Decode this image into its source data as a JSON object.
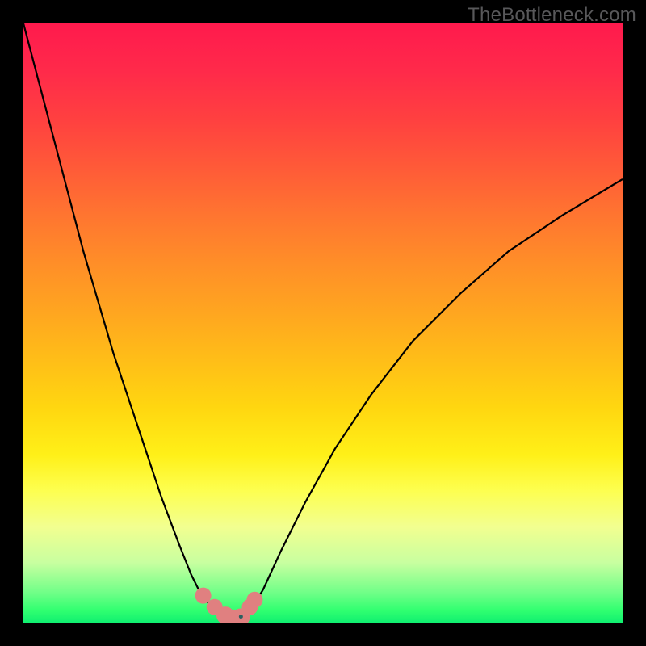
{
  "watermark": "TheBottleneck.com",
  "chart_data": {
    "type": "line",
    "title": "",
    "xlabel": "",
    "ylabel": "",
    "xlim": [
      0,
      1
    ],
    "ylim": [
      0,
      1
    ],
    "series": [
      {
        "name": "left-branch",
        "x": [
          0.0,
          0.05,
          0.1,
          0.15,
          0.2,
          0.23,
          0.26,
          0.28,
          0.3,
          0.33
        ],
        "y": [
          1.0,
          0.81,
          0.62,
          0.45,
          0.3,
          0.21,
          0.13,
          0.08,
          0.04,
          0.015
        ]
      },
      {
        "name": "valley",
        "x": [
          0.33,
          0.345,
          0.36,
          0.375
        ],
        "y": [
          0.015,
          0.006,
          0.006,
          0.015
        ]
      },
      {
        "name": "right-branch",
        "x": [
          0.375,
          0.4,
          0.43,
          0.47,
          0.52,
          0.58,
          0.65,
          0.73,
          0.81,
          0.9,
          1.0
        ],
        "y": [
          0.015,
          0.055,
          0.12,
          0.2,
          0.29,
          0.38,
          0.47,
          0.55,
          0.62,
          0.68,
          0.74
        ]
      }
    ],
    "markers": [
      {
        "name": "left-upper-dot",
        "x": 0.3,
        "y": 0.045,
        "r": 10
      },
      {
        "name": "left-lower-dot",
        "x": 0.319,
        "y": 0.026,
        "r": 10
      },
      {
        "name": "bottom-left-dot",
        "x": 0.337,
        "y": 0.012,
        "r": 11
      },
      {
        "name": "bottom-mid1-dot",
        "x": 0.35,
        "y": 0.007,
        "r": 11
      },
      {
        "name": "bottom-mid2-dot",
        "x": 0.363,
        "y": 0.009,
        "r": 11
      },
      {
        "name": "right-dot-1",
        "x": 0.378,
        "y": 0.026,
        "r": 10
      },
      {
        "name": "right-dot-2",
        "x": 0.386,
        "y": 0.038,
        "r": 10
      }
    ],
    "colors": {
      "curve": "#000000",
      "marker": "#e08080",
      "accent_dot": "#2a6060"
    }
  }
}
